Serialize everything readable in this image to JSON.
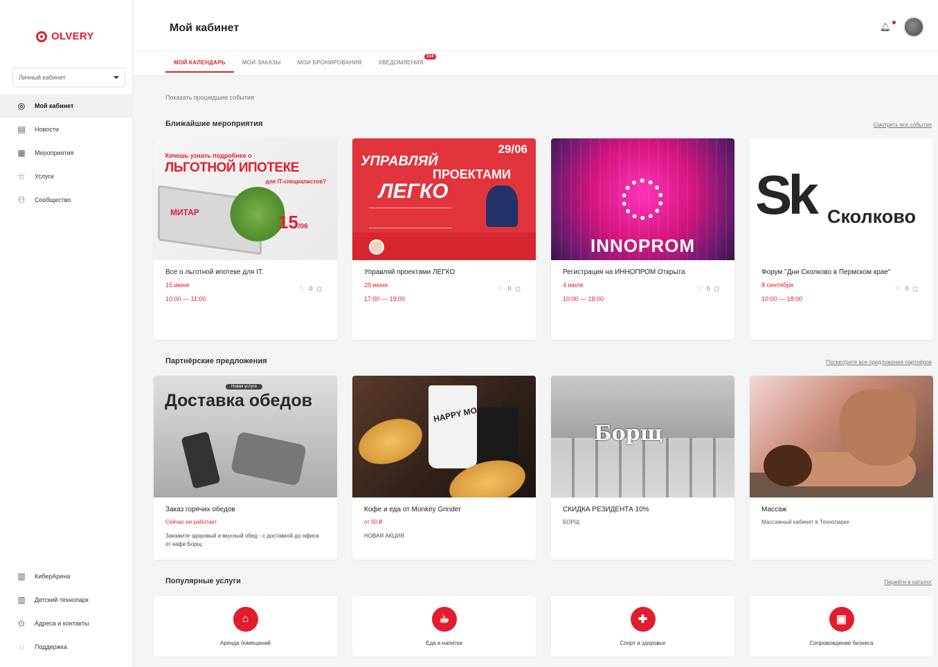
{
  "brand": {
    "logo_text": "OLVERY",
    "accent": "#e01e2d"
  },
  "sidebar": {
    "account_select": "Личный кабинет",
    "items": [
      {
        "label": "Мой кабинет",
        "icon": "olvery-logo-icon",
        "active": true
      },
      {
        "label": "Новости",
        "icon": "newspaper-icon"
      },
      {
        "label": "Мероприятия",
        "icon": "calendar-icon"
      },
      {
        "label": "Услуги",
        "icon": "star-icon"
      },
      {
        "label": "Сообщество",
        "icon": "people-icon"
      }
    ],
    "bottom_items": [
      {
        "label": "КиберАрена",
        "icon": "building-icon"
      },
      {
        "label": "Детский технопарк",
        "icon": "building-icon"
      },
      {
        "label": "Адреса и контакты",
        "icon": "pin-icon"
      },
      {
        "label": "Поддержка",
        "icon": "chat-icon"
      }
    ]
  },
  "header": {
    "title": "Мой кабинет",
    "tabs": [
      {
        "label": "МОЙ КАЛЕНДАРЬ",
        "active": true
      },
      {
        "label": "МОИ ЗАКАЗЫ"
      },
      {
        "label": "МОИ БРОНИРОВАНИЯ"
      },
      {
        "label": "УВЕДОМЛЕНИЯ",
        "badge": "316"
      }
    ]
  },
  "main": {
    "past_events_link": "Показать прошедшие события",
    "events_section": {
      "title": "Ближайшие мероприятия",
      "link": "Смотреть все события",
      "cards": [
        {
          "title": "Все о льготной ипотеке для IT.",
          "date": "15 июня",
          "time": "10:00 — 11:00",
          "likes": "0",
          "image": {
            "line1": "Хочешь узнать подробнее о",
            "line2": "ЛЬГОТНОЙ ИПОТЕКЕ",
            "line3": "для IT-специалистов?",
            "brand": "МИТАР",
            "date": "15",
            "month": "/06"
          }
        },
        {
          "title": "Управляй проектами ЛЕГКО",
          "date": "29 июня",
          "time": "17:00 — 19:00",
          "likes": "0",
          "image": {
            "date": "29/06",
            "line1": "УПРАВЛЯЙ",
            "line2": "ПРОЕКТАМИ",
            "line3": "ЛЕГКО"
          }
        },
        {
          "title": "Регистрация на ИННОПРОМ Открыта",
          "date": "4 июля",
          "time": "10:00 — 18:00",
          "likes": "0",
          "image": {
            "brand": "INNOPROM"
          }
        },
        {
          "title": "Форум \"Дни Сколково в Пермском крае\"",
          "date": "8 сентября",
          "time": "10:00 — 18:00",
          "likes": "0",
          "image": {
            "mark": "Sk",
            "name": "Сколково"
          }
        }
      ]
    },
    "offers_section": {
      "title": "Партнёрские предложения",
      "link": "Посмотрите все предложения партнёров",
      "cards": [
        {
          "title": "Заказ горячих обедов",
          "sub": "Сейчас не работает",
          "desc": "Закажите здоровый и вкусный обед - с доставкой до офиса от кафе Борщ",
          "image": {
            "tag": "Новая услуга",
            "title": "Доставка обедов"
          }
        },
        {
          "title": "Кофе и еда от Monkey Grinder",
          "sub": "от 50 ₽",
          "desc": "НОВАЯ АКЦИЯ",
          "image": {
            "cup_text": "HAPPY MONKEY DAY"
          }
        },
        {
          "title": "СКИДКА РЕЗИДЕНТА 10%",
          "sub": "БОРЩ",
          "desc": "",
          "image": {
            "logo": "Борщ"
          }
        },
        {
          "title": "Массаж",
          "sub": "Массажный кабинет в Технопарке",
          "desc": "",
          "image": {}
        }
      ]
    },
    "services_section": {
      "title": "Популярные услуги",
      "link": "Перейти в каталог",
      "cards": [
        {
          "label": "Аренда помещений",
          "icon": "tag-icon"
        },
        {
          "label": "Еда и напитки",
          "icon": "food-icon"
        },
        {
          "label": "Спорт и здоровье",
          "icon": "dumbbell-icon"
        },
        {
          "label": "Сопровождение бизнеса",
          "icon": "briefcase-icon"
        }
      ]
    }
  }
}
